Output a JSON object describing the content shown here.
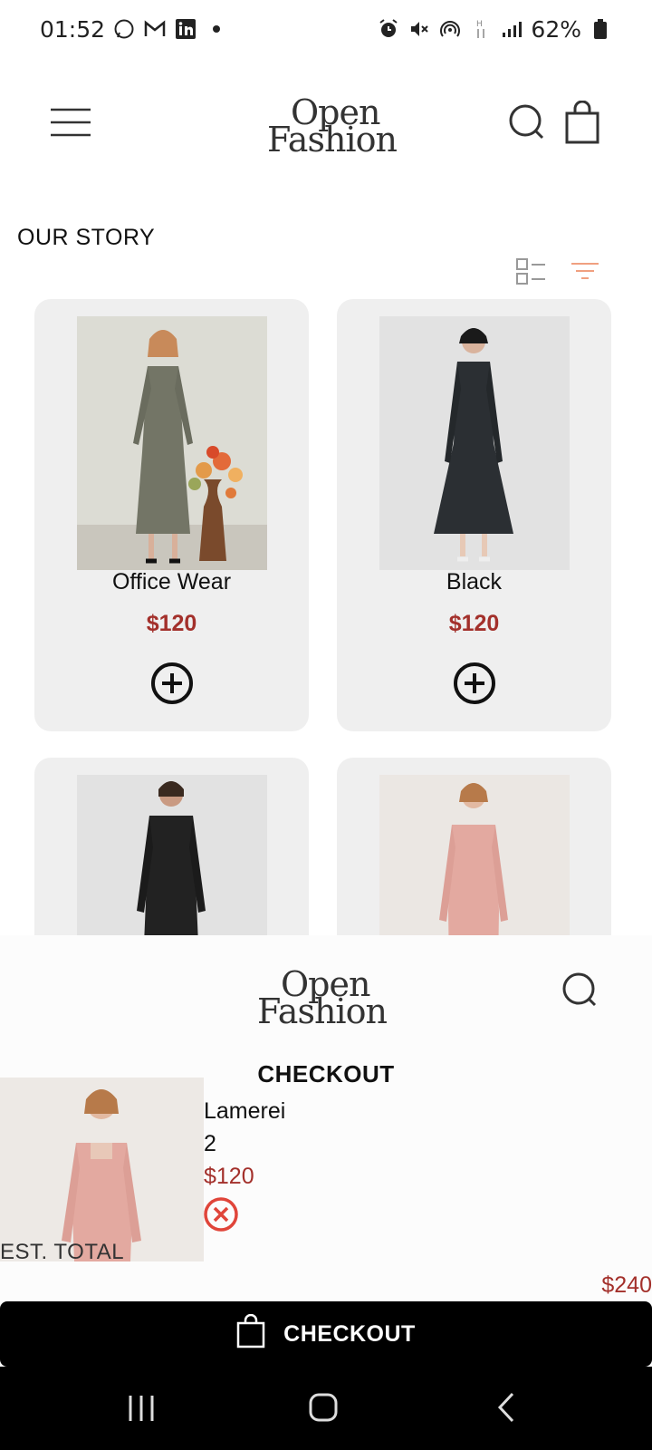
{
  "status_bar": {
    "time": "01:52",
    "battery": "62%",
    "left_icons": [
      "whatsapp-icon",
      "gmail-icon",
      "linkedin-icon",
      "dot-icon"
    ],
    "right_icons": [
      "alarm-icon",
      "mute-icon",
      "hotspot-icon",
      "data-icon",
      "signal-icon",
      "battery-icon"
    ]
  },
  "header": {
    "logo_line1": "Open",
    "logo_line2": "Fashion"
  },
  "section": {
    "title": "OUR STORY"
  },
  "products": [
    {
      "name": "Office Wear",
      "price": "$120"
    },
    {
      "name": "Black",
      "price": "$120"
    },
    {
      "name": "",
      "price": ""
    },
    {
      "name": "",
      "price": ""
    }
  ],
  "checkout": {
    "logo_line1": "Open",
    "logo_line2": "Fashion",
    "title": "CHECKOUT",
    "item": {
      "name": "Lamerei",
      "qty": "2",
      "price": "$120"
    },
    "est_label": "EST. TOTAL",
    "total": "$240",
    "button_label": "CHECKOUT"
  },
  "colors": {
    "accent_price": "#a3302b",
    "card_bg": "#efefef",
    "filter_icon": "#f0a080"
  }
}
